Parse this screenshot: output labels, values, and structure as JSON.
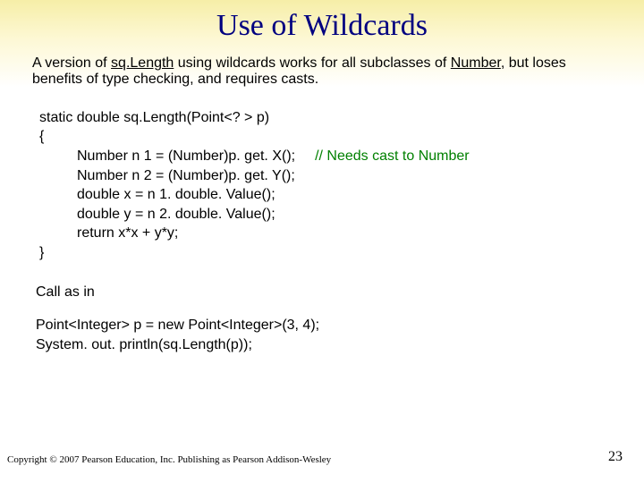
{
  "title": "Use of Wildcards",
  "intro": {
    "part1": "A version of ",
    "u1": "sq.Length",
    "part2": " using wildcards works for all subclasses of ",
    "u2": "Number",
    "part3": ",  but loses benefits of type checking, and requires casts."
  },
  "code": {
    "l1": "static double sq.Length(Point<? > p)",
    "l2": "{",
    "l3": "Number n 1 = (Number)p. get. X();",
    "l3_comment": "// Needs cast to Number",
    "l4": "Number n 2 = (Number)p. get. Y();",
    "l5": "double x = n 1. double. Value();",
    "l6": "double y = n 2. double. Value();",
    "l7": "return x*x + y*y;",
    "l8": "}"
  },
  "after": {
    "call_as": "Call as in",
    "c1": "Point<Integer> p = new Point<Integer>(3, 4);",
    "c2": "System. out. println(sq.Length(p));"
  },
  "footer": "Copyright © 2007 Pearson Education, Inc. Publishing as Pearson Addison-Wesley",
  "page_number": "23"
}
